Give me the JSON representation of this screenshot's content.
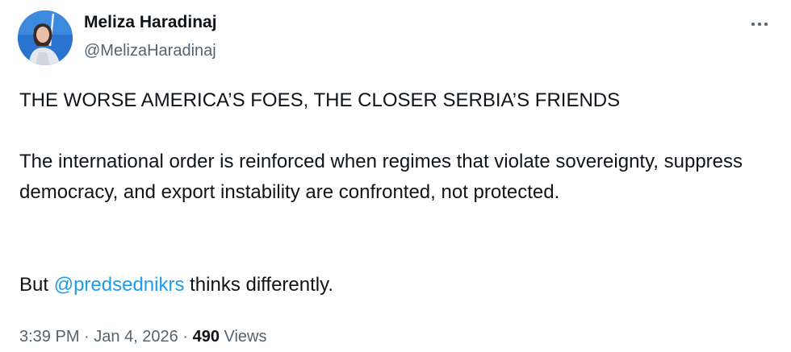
{
  "author": {
    "display_name": "Meliza Haradinaj",
    "handle": "@MelizaHaradinaj"
  },
  "menu": {
    "more_icon": "more-horizontal-icon"
  },
  "tweet": {
    "heading": "THE WORSE AMERICA’S FOES, THE CLOSER SERBIA’S FRIENDS",
    "paragraph": "The international order is reinforced when regimes that violate sovereignty, suppress democracy, and export instability are confronted, not protected.",
    "closing_prefix": "But ",
    "mention": "@predsednikrs",
    "closing_suffix": " thinks differently."
  },
  "meta": {
    "time": "3:39 PM",
    "separator_1": " · ",
    "date": "Jan 4, 2026",
    "separator_2": " · ",
    "views_count": "490",
    "views_label": " Views"
  },
  "colors": {
    "text_primary": "#0f1419",
    "text_secondary": "#536471",
    "link": "#1d9bf0"
  }
}
